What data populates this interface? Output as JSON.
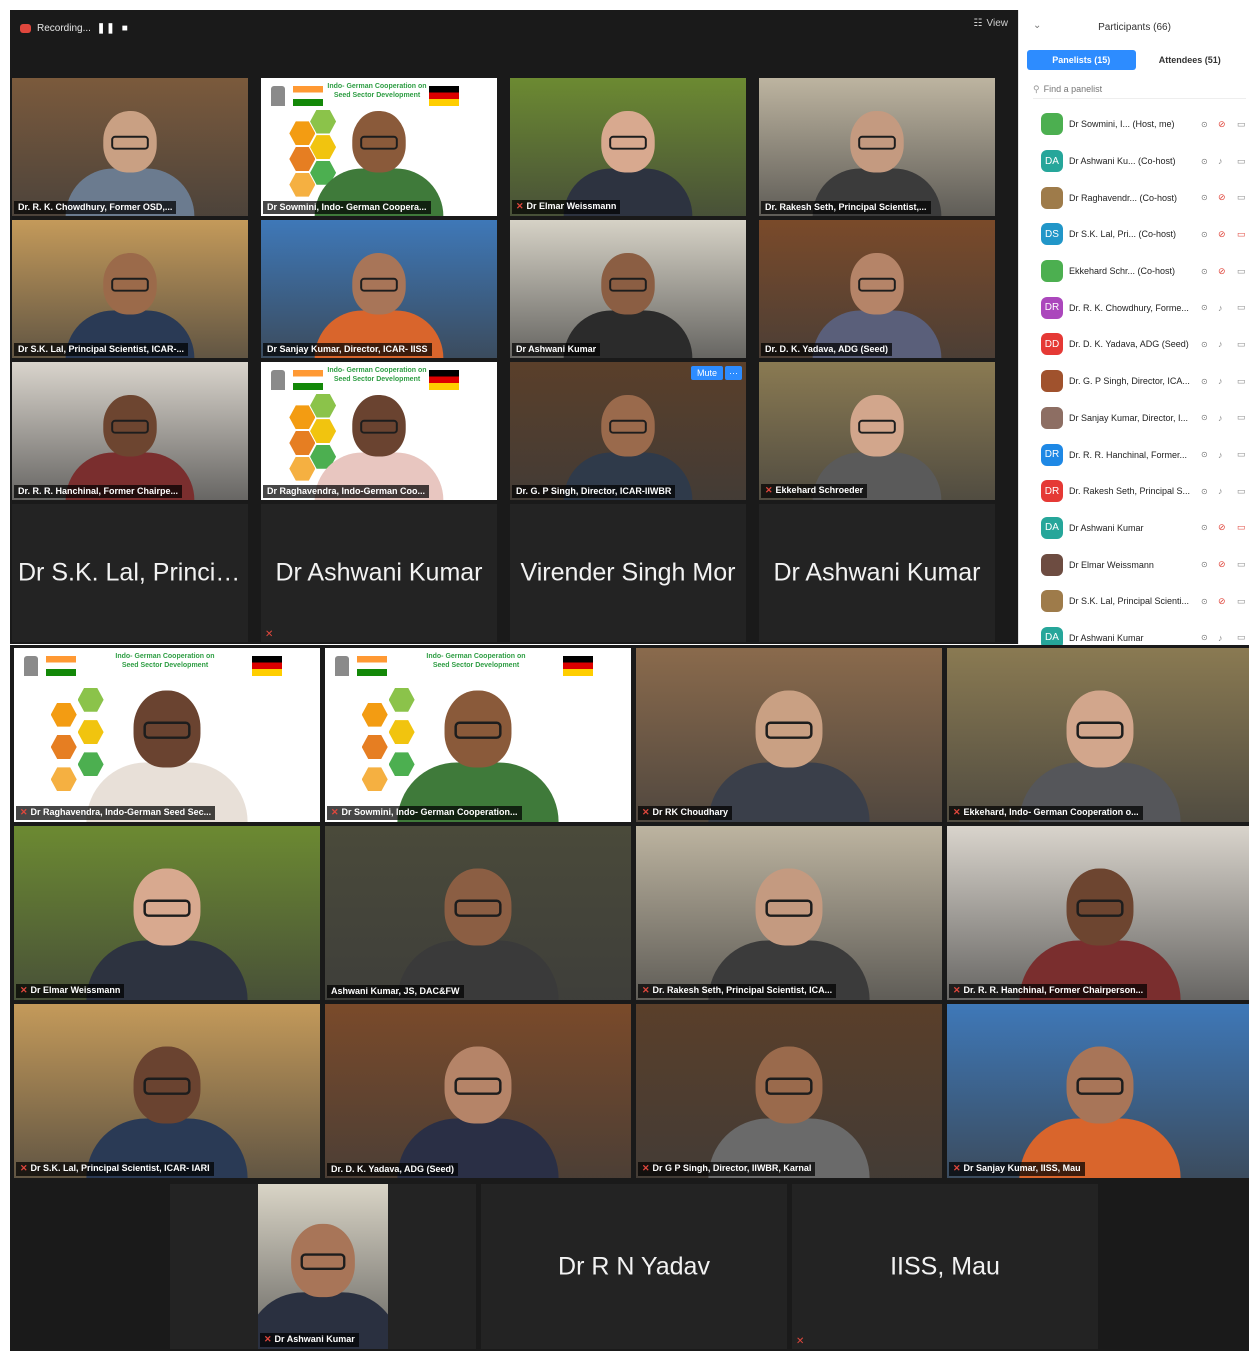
{
  "top": {
    "recording_label": "Recording...",
    "pause_symbol": "❚❚",
    "stop_symbol": "■",
    "view_label": "View",
    "view_icon": "grid-icon"
  },
  "gallery_top": {
    "tiles": [
      {
        "name": "Dr. R. K. Chowdhury, Former OSD,...",
        "muted": false,
        "kind": "video",
        "skin": "#c9a083",
        "shirt": "#6b7b8f",
        "bg": "#7b5a3c",
        "active": false
      },
      {
        "name": "Dr Sowmini, Indo- German Coopera...",
        "muted": false,
        "kind": "slide",
        "skin": "#8a5a3a",
        "shirt": "#3f7a3a",
        "bg": "#ffffff",
        "active": false
      },
      {
        "name": "Dr Elmar Weissmann",
        "muted": true,
        "kind": "video",
        "skin": "#d8a98f",
        "shirt": "#2d3340",
        "bg": "#6c8a32",
        "active": false
      },
      {
        "name": "Dr. Rakesh Seth, Principal Scientist,...",
        "muted": false,
        "kind": "video",
        "skin": "#c49a80",
        "shirt": "#3b3b3b",
        "bg": "#bdb4a0",
        "active": false
      },
      {
        "name": "Dr S.K. Lal, Principal Scientist, ICAR-...",
        "muted": false,
        "kind": "video",
        "skin": "#9b6a4a",
        "shirt": "#2a3a55",
        "bg": "#c49a5a",
        "active": false
      },
      {
        "name": "Dr Sanjay Kumar, Director, ICAR- IISS",
        "muted": false,
        "kind": "video",
        "skin": "#a87558",
        "shirt": "#d9652c",
        "bg": "#3e78b8",
        "active": false
      },
      {
        "name": "Dr Ashwani Kumar",
        "muted": false,
        "kind": "video",
        "skin": "#8b5e43",
        "shirt": "#2b2b2b",
        "bg": "#d6d2c6",
        "active": false
      },
      {
        "name": "Dr. D. K. Yadava, ADG (Seed)",
        "muted": false,
        "kind": "video",
        "skin": "#b58468",
        "shirt": "#5a5f7a",
        "bg": "#7a4a2a",
        "active": true
      },
      {
        "name": "Dr. R. R. Hanchinal, Former Chairpe...",
        "muted": false,
        "kind": "video",
        "skin": "#6d4530",
        "shirt": "#7a2e2e",
        "bg": "#d9d4cc",
        "active": false
      },
      {
        "name": "Dr Raghavendra, Indo-German Coo...",
        "muted": false,
        "kind": "slide",
        "skin": "#6a4330",
        "shirt": "#e8c6c0",
        "bg": "#ffffff",
        "active": false
      },
      {
        "name": "Dr. G. P Singh, Director, ICAR-IIWBR",
        "muted": false,
        "kind": "video",
        "skin": "#9a6a4c",
        "shirt": "#2f3a4a",
        "bg": "#5a3f2a",
        "active": false,
        "mute_button": "Mute",
        "more_button": "···"
      },
      {
        "name": "Ekkehard Schroeder",
        "muted": true,
        "kind": "video",
        "skin": "#d2a68c",
        "shirt": "#5a5a5a",
        "bg": "#8a7a52",
        "active": false
      }
    ],
    "name_only_tiles": [
      {
        "name": "Dr S.K. Lal, Princip...",
        "muted": false
      },
      {
        "name": "Dr Ashwani Kumar",
        "muted": true
      },
      {
        "name": "Virender Singh Mor",
        "muted": false
      },
      {
        "name": "Dr Ashwani Kumar",
        "muted": false
      }
    ]
  },
  "slide": {
    "title_line1": "Indo- German Cooperation on",
    "title_line2": "Seed Sector Development"
  },
  "participants": {
    "title": "Participants (66)",
    "tab_panelists": "Panelists (15)",
    "tab_attendees": "Attendees (51)",
    "search_placeholder": "Find a panelist",
    "rows": [
      {
        "initials": "",
        "color": "#4caf50",
        "name": "Dr Sowmini, I... (Host, me)",
        "mic_muted": true,
        "cam_off": false
      },
      {
        "initials": "DA",
        "color": "#26a69a",
        "name": "Dr Ashwani Ku... (Co-host)",
        "mic_muted": false,
        "cam_off": false
      },
      {
        "initials": "",
        "color": "#9e7b4a",
        "name": "Dr Raghavendr... (Co-host)",
        "mic_muted": true,
        "cam_off": false
      },
      {
        "initials": "DS",
        "color": "#2196c8",
        "name": "Dr S.K. Lal, Pri... (Co-host)",
        "mic_muted": true,
        "cam_off": true
      },
      {
        "initials": "",
        "color": "#4caf50",
        "name": "Ekkehard Schr... (Co-host)",
        "mic_muted": true,
        "cam_off": false
      },
      {
        "initials": "DR",
        "color": "#ab47bc",
        "name": "Dr. R. K. Chowdhury, Forme...",
        "mic_muted": false,
        "cam_off": false
      },
      {
        "initials": "DD",
        "color": "#e53935",
        "name": "Dr. D. K. Yadava, ADG (Seed)",
        "mic_muted": false,
        "cam_off": false
      },
      {
        "initials": "",
        "color": "#a0522d",
        "name": "Dr. G. P Singh, Director, ICA...",
        "mic_muted": false,
        "cam_off": false
      },
      {
        "initials": "",
        "color": "#8d6e63",
        "name": "Dr Sanjay Kumar, Director, I...",
        "mic_muted": false,
        "cam_off": false
      },
      {
        "initials": "DR",
        "color": "#1e88e5",
        "name": "Dr. R. R. Hanchinal, Former...",
        "mic_muted": false,
        "cam_off": false
      },
      {
        "initials": "DR",
        "color": "#e53935",
        "name": "Dr. Rakesh Seth, Principal S...",
        "mic_muted": false,
        "cam_off": false
      },
      {
        "initials": "DA",
        "color": "#26a69a",
        "name": "Dr Ashwani Kumar",
        "mic_muted": true,
        "cam_off": true
      },
      {
        "initials": "",
        "color": "#6d4c41",
        "name": "Dr Elmar Weissmann",
        "mic_muted": true,
        "cam_off": false
      },
      {
        "initials": "",
        "color": "#9e7b4a",
        "name": "Dr S.K. Lal, Principal Scienti...",
        "mic_muted": true,
        "cam_off": false
      },
      {
        "initials": "DA",
        "color": "#26a69a",
        "name": "Dr Ashwani Kumar",
        "mic_muted": false,
        "cam_off": false
      }
    ]
  },
  "gallery_bottom": {
    "tiles": [
      {
        "name": "Dr Raghavendra, Indo-German Seed Sec...",
        "muted": true,
        "kind": "slide",
        "skin": "#6a4330",
        "shirt": "#e8e0d8",
        "bg": "#ffffff",
        "active": false
      },
      {
        "name": "Dr Sowmini, Indo- German Cooperation...",
        "muted": true,
        "kind": "slide",
        "skin": "#8a5a3a",
        "shirt": "#3f7a3a",
        "bg": "#ffffff",
        "active": false
      },
      {
        "name": "Dr RK Choudhary",
        "muted": true,
        "kind": "video",
        "skin": "#c9a083",
        "shirt": "#3a3f4a",
        "bg": "#8a6a4c",
        "active": false
      },
      {
        "name": "Ekkehard, Indo- German Cooperation o...",
        "muted": true,
        "kind": "video",
        "skin": "#d2a68c",
        "shirt": "#55565a",
        "bg": "#8a7a52",
        "active": false
      },
      {
        "name": "Dr Elmar Weissmann",
        "muted": true,
        "kind": "video",
        "skin": "#d8a98f",
        "shirt": "#2d3340",
        "bg": "#6c8a32",
        "active": false
      },
      {
        "name": "Ashwani Kumar, JS, DAC&FW",
        "muted": false,
        "kind": "video",
        "skin": "#8b5e43",
        "shirt": "#3a3a3a",
        "bg": "#4a4a3a",
        "active": true
      },
      {
        "name": "Dr. Rakesh Seth, Principal Scientist, ICA...",
        "muted": true,
        "kind": "video",
        "skin": "#c49a80",
        "shirt": "#3b3b3b",
        "bg": "#bdb4a0",
        "active": false
      },
      {
        "name": "Dr. R. R. Hanchinal, Former Chairperson...",
        "muted": true,
        "kind": "video",
        "skin": "#6d4530",
        "shirt": "#7a2e2e",
        "bg": "#d9d4cc",
        "active": false
      },
      {
        "name": "Dr S.K. Lal, Principal Scientist, ICAR- IARI",
        "muted": true,
        "kind": "video",
        "skin": "#6a4330",
        "shirt": "#2a3a55",
        "bg": "#c49a5a",
        "active": false
      },
      {
        "name": "Dr. D. K. Yadava, ADG (Seed)",
        "muted": false,
        "kind": "video",
        "skin": "#b58468",
        "shirt": "#2a2f45",
        "bg": "#7a4a2a",
        "active": false
      },
      {
        "name": "Dr G P Singh, Director, IIWBR, Karnal",
        "muted": true,
        "kind": "video",
        "skin": "#9a6a4c",
        "shirt": "#6a6a6a",
        "bg": "#5a3f2a",
        "active": false
      },
      {
        "name": "Dr Sanjay Kumar, IISS, Mau",
        "muted": true,
        "kind": "video",
        "skin": "#a87558",
        "shirt": "#d9652c",
        "bg": "#3e78b8",
        "active": false
      }
    ],
    "last_row": [
      {
        "name": "Dr Ashwani Kumar",
        "muted": true,
        "kind": "video",
        "skin": "#a87558",
        "shirt": "#2a3040",
        "bg": "#d9d4c6"
      },
      {
        "name": "Dr R N Yadav",
        "muted": false,
        "kind": "name"
      },
      {
        "name": "IISS, Mau",
        "muted": true,
        "kind": "name"
      }
    ]
  }
}
